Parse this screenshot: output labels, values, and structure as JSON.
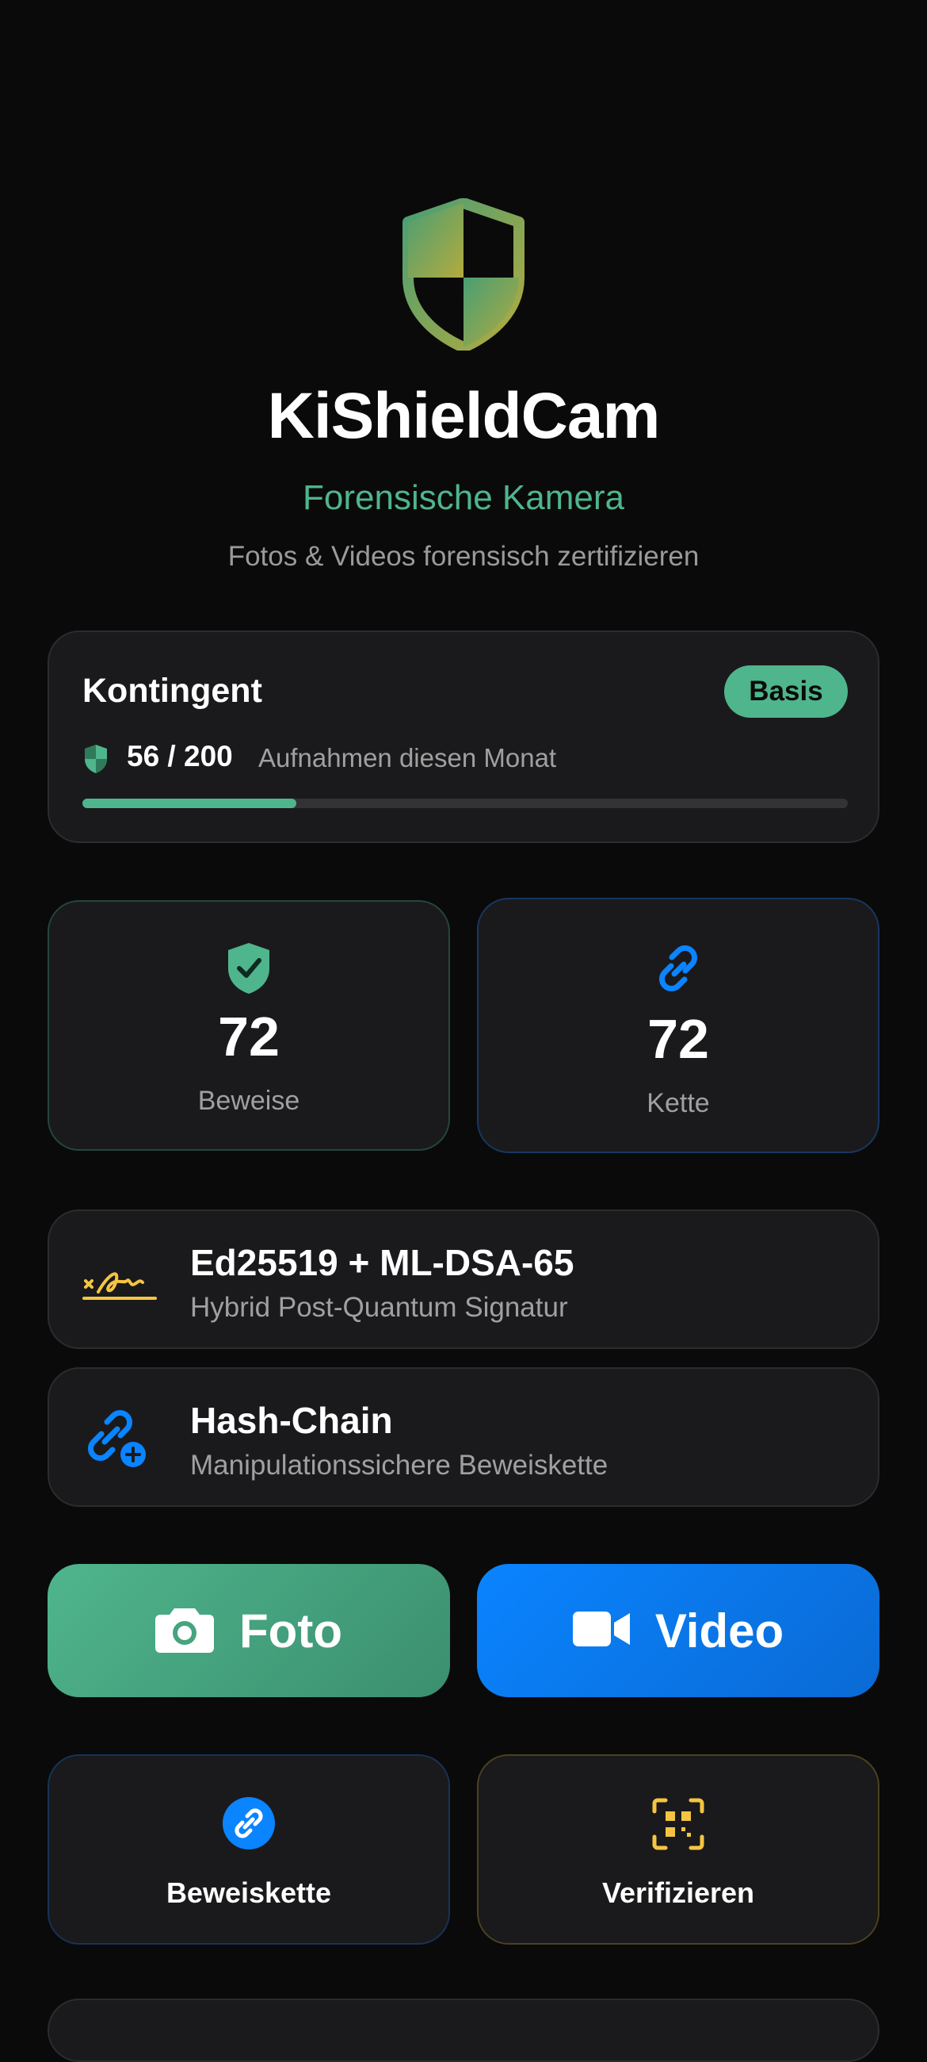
{
  "header": {
    "app_title": "KiShieldCam",
    "subtitle": "Forensische Kamera",
    "tagline": "Fotos & Videos forensisch zertifizieren",
    "logo_icon": "shield-icon"
  },
  "quota": {
    "title": "Kontingent",
    "plan_badge": "Basis",
    "count": "56 / 200",
    "used": 56,
    "limit": 200,
    "label": "Aufnahmen diesen Monat",
    "progress_fraction": 0.28
  },
  "stats": [
    {
      "icon": "shield-check-icon",
      "value": "72",
      "label": "Beweise"
    },
    {
      "icon": "link-icon",
      "value": "72",
      "label": "Kette"
    }
  ],
  "features": [
    {
      "icon": "signature-icon",
      "title": "Ed25519 + ML-DSA-65",
      "subtitle": "Hybrid Post-Quantum Signatur"
    },
    {
      "icon": "chain-add-icon",
      "title": "Hash-Chain",
      "subtitle": "Manipulationssichere Beweiskette"
    }
  ],
  "capture": {
    "photo_label": "Foto",
    "photo_icon": "camera-icon",
    "video_label": "Video",
    "video_icon": "video-camera-icon"
  },
  "actions": [
    {
      "icon": "link-circle-icon",
      "label": "Beweiskette"
    },
    {
      "icon": "qr-scan-icon",
      "label": "Verifizieren"
    }
  ],
  "colors": {
    "background": "#0a0a0a",
    "card": "#1a1a1c",
    "accent_green": "#4fb58d",
    "accent_blue": "#0a84ff",
    "accent_yellow": "#f5c542"
  }
}
